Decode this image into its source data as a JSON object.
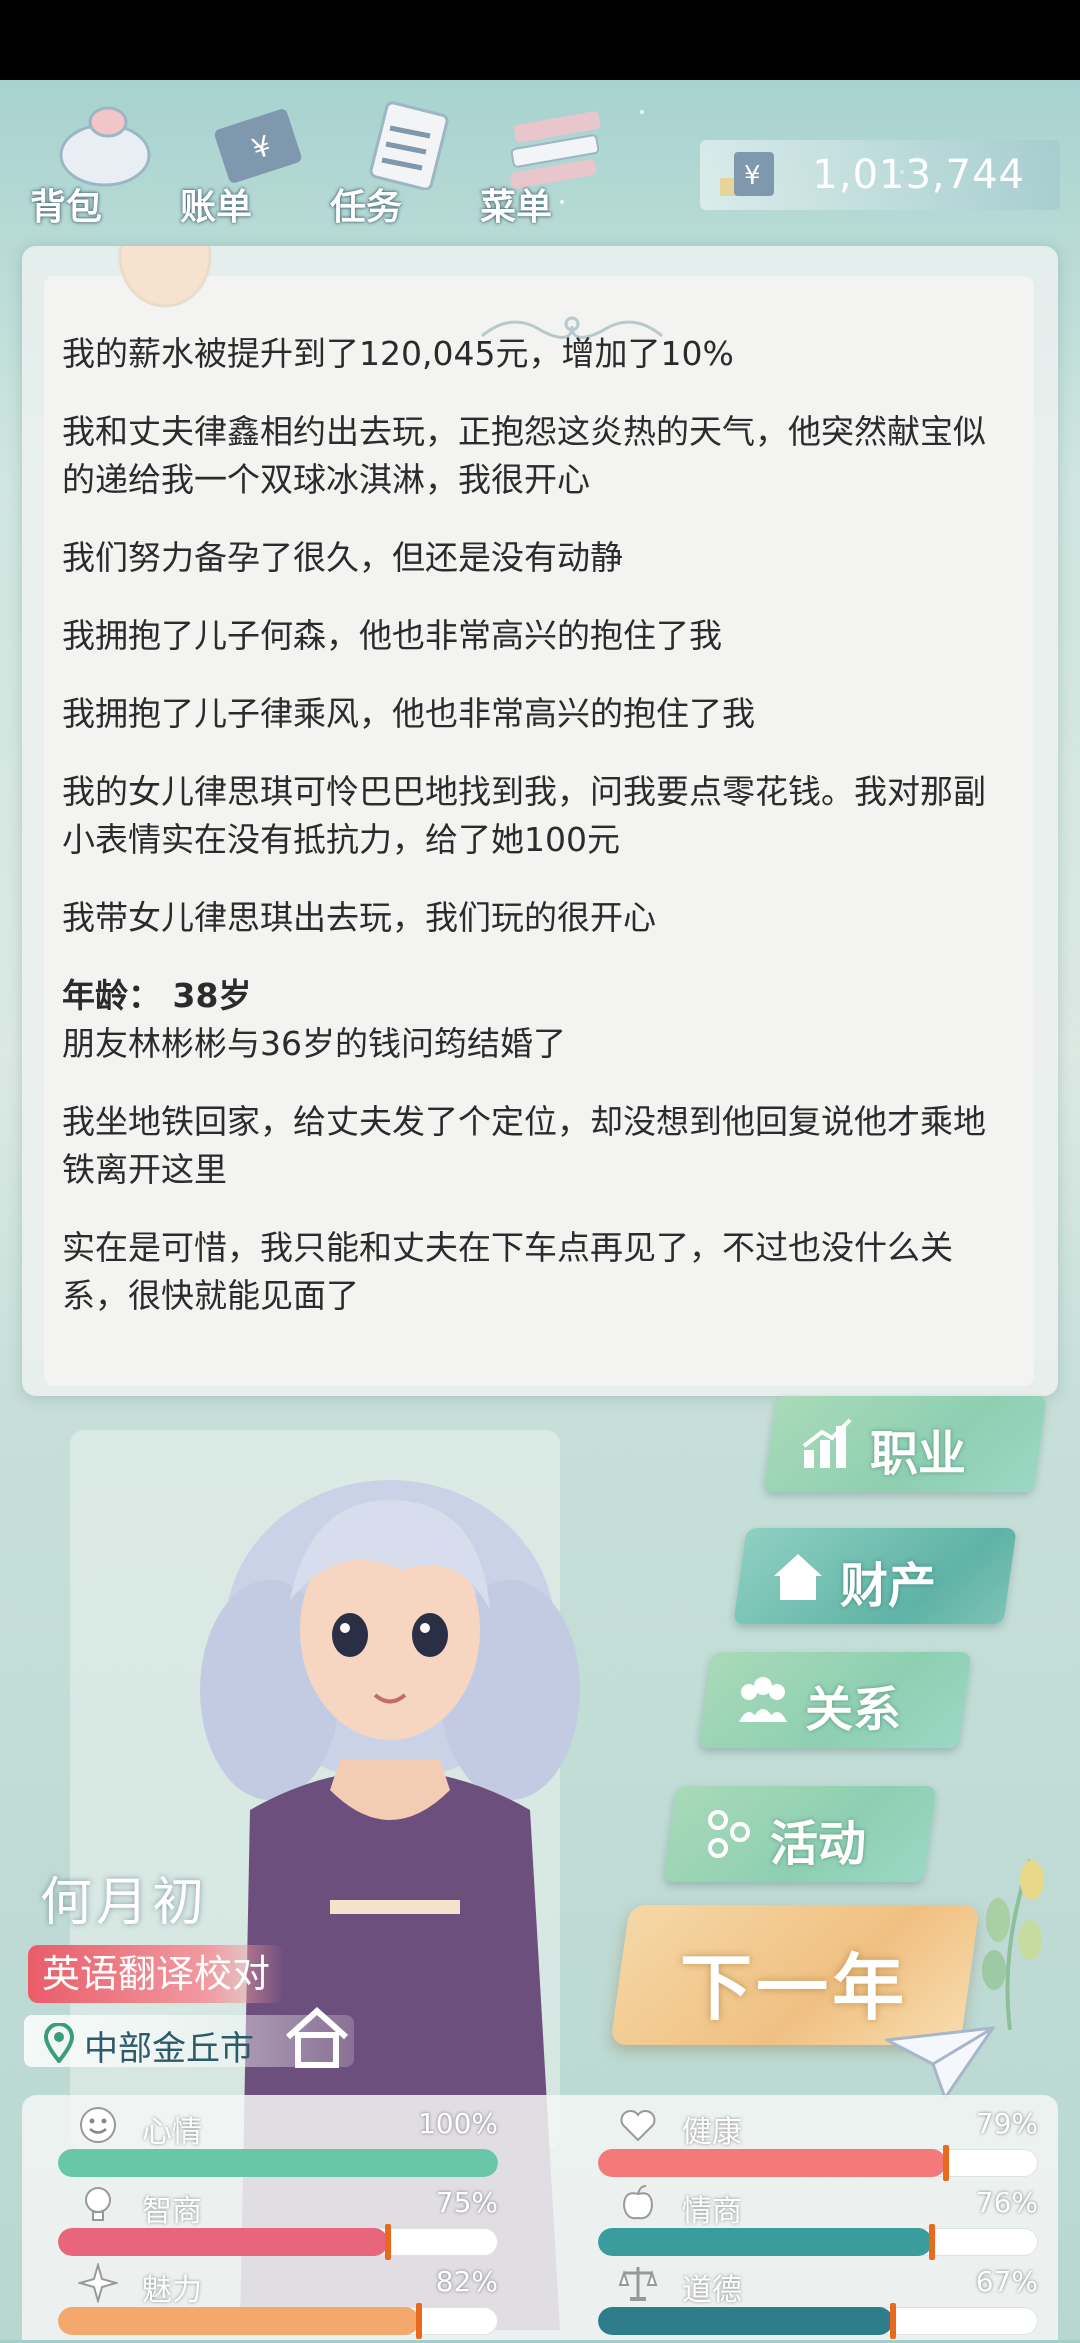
{
  "topbar": {
    "items": [
      {
        "label": "背包",
        "icon": "bag-icon"
      },
      {
        "label": "账单",
        "icon": "bill-icon"
      },
      {
        "label": "任务",
        "icon": "task-icon"
      },
      {
        "label": "菜单",
        "icon": "menu-icon"
      }
    ],
    "money": {
      "icon": "yen-icon",
      "value": "1,013,744"
    }
  },
  "log": {
    "entries_before": [
      "我的薪水被提升到了120,045元，增加了10%",
      "我和丈夫律鑫相约出去玩，正抱怨这炎热的天气，他突然献宝似的递给我一个双球冰淇淋，我很开心",
      "我们努力备孕了很久，但还是没有动静",
      "我拥抱了儿子何森，他也非常高兴的抱住了我",
      "我拥抱了儿子律乘风，他也非常高兴的抱住了我",
      "我的女儿律思琪可怜巴巴地找到我，问我要点零花钱。我对那副小表情实在没有抵抗力，给了她100元",
      "我带女儿律思琪出去玩，我们玩的很开心"
    ],
    "age_heading": "年龄：  38岁",
    "entries_after": [
      "朋友林彬彬与36岁的钱问筠结婚了",
      "我坐地铁回家，给丈夫发了个定位，却没想到他回复说他才乘地铁离开这里",
      "实在是可惜，我只能和丈夫在下车点再见了，不过也没什么关系，很快就能见面了"
    ]
  },
  "character": {
    "name": "何月初",
    "job": "英语翻译校对",
    "location": "中部金丘市"
  },
  "actions": {
    "career": "职业",
    "assets": "财产",
    "relation": "关系",
    "activity": "活动",
    "next_year": "下一年"
  },
  "stats": [
    {
      "label": "心情",
      "value": "100%",
      "fraction": 1.0,
      "color": "#67c7a6",
      "icon": "smile-icon"
    },
    {
      "label": "健康",
      "value": "79%",
      "fraction": 0.79,
      "color": "#f47a79",
      "icon": "heart-icon"
    },
    {
      "label": "智商",
      "value": "75%",
      "fraction": 0.75,
      "color": "#e9657b",
      "icon": "brain-bulb-icon"
    },
    {
      "label": "情商",
      "value": "76%",
      "fraction": 0.76,
      "color": "#3a9c9c",
      "icon": "apple-icon"
    },
    {
      "label": "魅力",
      "value": "82%",
      "fraction": 0.82,
      "color": "#f4a86b",
      "icon": "sparkle-icon"
    },
    {
      "label": "道德",
      "value": "67%",
      "fraction": 0.67,
      "color": "#2f7c8a",
      "icon": "scales-icon"
    }
  ]
}
